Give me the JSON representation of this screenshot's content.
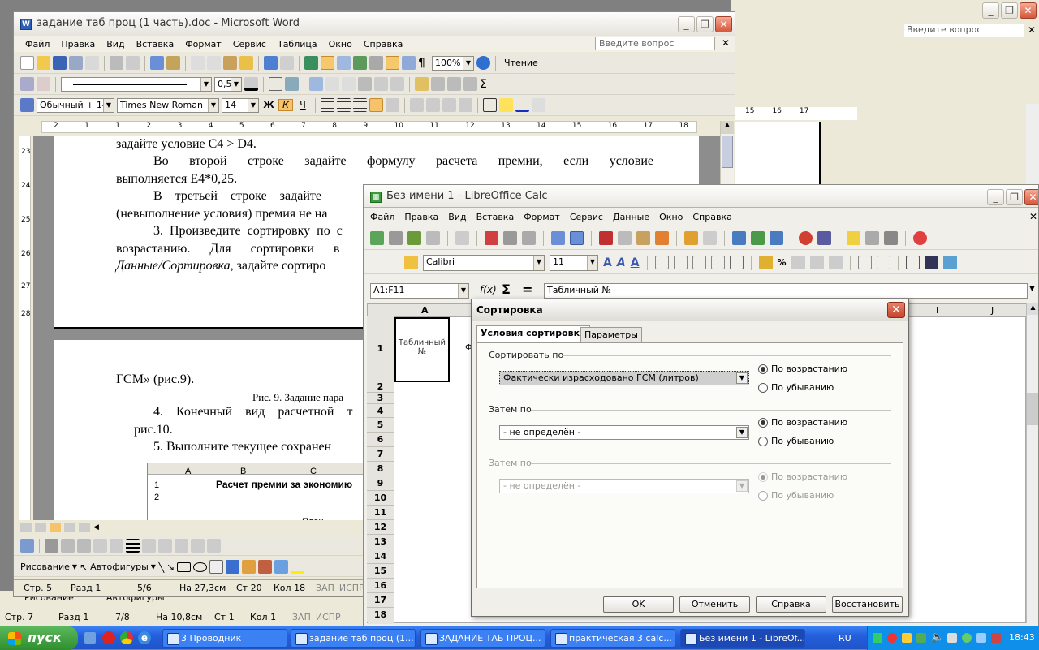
{
  "bg_window": {
    "search_placeholder": "Введите вопрос",
    "ruler_marks": [
      "15",
      "16",
      "17"
    ]
  },
  "word": {
    "title": "задание таб проц (1 часть).doc - Microsoft Word",
    "menu": [
      "Файл",
      "Правка",
      "Вид",
      "Вставка",
      "Формат",
      "Сервис",
      "Таблица",
      "Окно",
      "Справка"
    ],
    "help_placeholder": "Введите вопрос",
    "zoom": "100%",
    "reading_label": "Чтение",
    "line_width": "0,5",
    "style": "Обычный + 14 г",
    "font": "Times New Roman",
    "font_size": "14",
    "bold": "Ж",
    "italic": "К",
    "underline": "Ч",
    "ruler_labels": [
      "2",
      "1",
      "1",
      "2",
      "3",
      "4",
      "5",
      "6",
      "7",
      "8",
      "9",
      "10",
      "11",
      "12",
      "13",
      "14",
      "15",
      "16",
      "17",
      "18"
    ],
    "page1_lines": [
      "задайте условие C4 > D4.",
      "Во второй строке задайте формулу расчета премии, если условие",
      "выполняется E4*0,25.",
      "В третьей строке задайте",
      "(невыполнение условия) премия не на",
      "3. Произведите сортировку по с",
      "возрастанию. Для сортировки в",
      "Данные/Сортировка,",
      " задайте сортиро"
    ],
    "page2_lines": [
      "ГСМ» (рис.9).",
      "Рис. 9. Задание пара",
      "4. Конечный вид расчетной т",
      "рис.10.",
      "5. Выполните текущее сохранен"
    ],
    "vruler_labels": [
      "23",
      "24",
      "25",
      "26",
      "27",
      "28"
    ],
    "embedded_sheet": {
      "cols": [
        "A",
        "B",
        "C"
      ],
      "rows": [
        "1",
        "2"
      ],
      "title_cell": "Расчет премии за экономию",
      "cell_c": "План"
    },
    "draw_toolbar": {
      "drawing": "Рисование",
      "autoshapes": "Автофигуры"
    },
    "status": {
      "page": "Стр. 5",
      "section": "Разд 1",
      "pages": "5/6",
      "at": "На 27,3см",
      "line": "Ст 20",
      "col": "Кол 18",
      "rec": "ЗАП",
      "fix": "ИСПР"
    }
  },
  "word2": {
    "status": {
      "page": "Стр. 7",
      "section": "Разд 1",
      "pages": "7/8",
      "at": "На 10,8см",
      "line": "Ст 1",
      "col": "Кол 1",
      "rec": "ЗАП",
      "fix": "ИСПР"
    },
    "drawing": "Рисование",
    "autoshapes": "Автофигуры"
  },
  "calc": {
    "title": "Без имени 1 - LibreOffice Calc",
    "menu": [
      "Файл",
      "Правка",
      "Вид",
      "Вставка",
      "Формат",
      "Сервис",
      "Данные",
      "Окно",
      "Справка"
    ],
    "font": "Calibri",
    "font_size": "11",
    "name_box": "A1:F11",
    "formula": "Табличный №",
    "fx": "f(x)",
    "sum": "Σ",
    "eq": "=",
    "cols": [
      "A",
      "I",
      "J"
    ],
    "rows": [
      "1",
      "2",
      "3",
      "4",
      "5",
      "6",
      "7",
      "8",
      "9",
      "10",
      "11",
      "12",
      "13",
      "14",
      "15",
      "16",
      "17",
      "18"
    ],
    "cell_a1": "Табличный №",
    "cell_b1_partial": "Ф"
  },
  "dialog": {
    "title": "Сортировка",
    "tabs": [
      "Условия сортировки",
      "Параметры"
    ],
    "groups": [
      {
        "label": "Сортировать по",
        "value": "Фактически израсходовано ГСМ (литров)",
        "asc": "По возрастанию",
        "desc": "По убыванию",
        "enabled": true
      },
      {
        "label": "Затем по",
        "value": "- не определён -",
        "asc": "По возрастанию",
        "desc": "По убыванию",
        "enabled": true
      },
      {
        "label": "Затем по",
        "value": "- не определён -",
        "asc": "По возрастанию",
        "desc": "По убыванию",
        "enabled": false
      }
    ],
    "buttons": {
      "ok": "OK",
      "cancel": "Отменить",
      "help": "Справка",
      "reset": "Восстановить"
    }
  },
  "taskbar": {
    "start": "пуск",
    "tasks": [
      "3 Проводник",
      "задание таб проц (1...",
      "ЗАДАНИЕ ТАБ ПРОЦ...",
      "практическая 3 calc...",
      "Без имени 1 - LibreOf..."
    ],
    "lang": "RU",
    "clock": "18:43"
  }
}
